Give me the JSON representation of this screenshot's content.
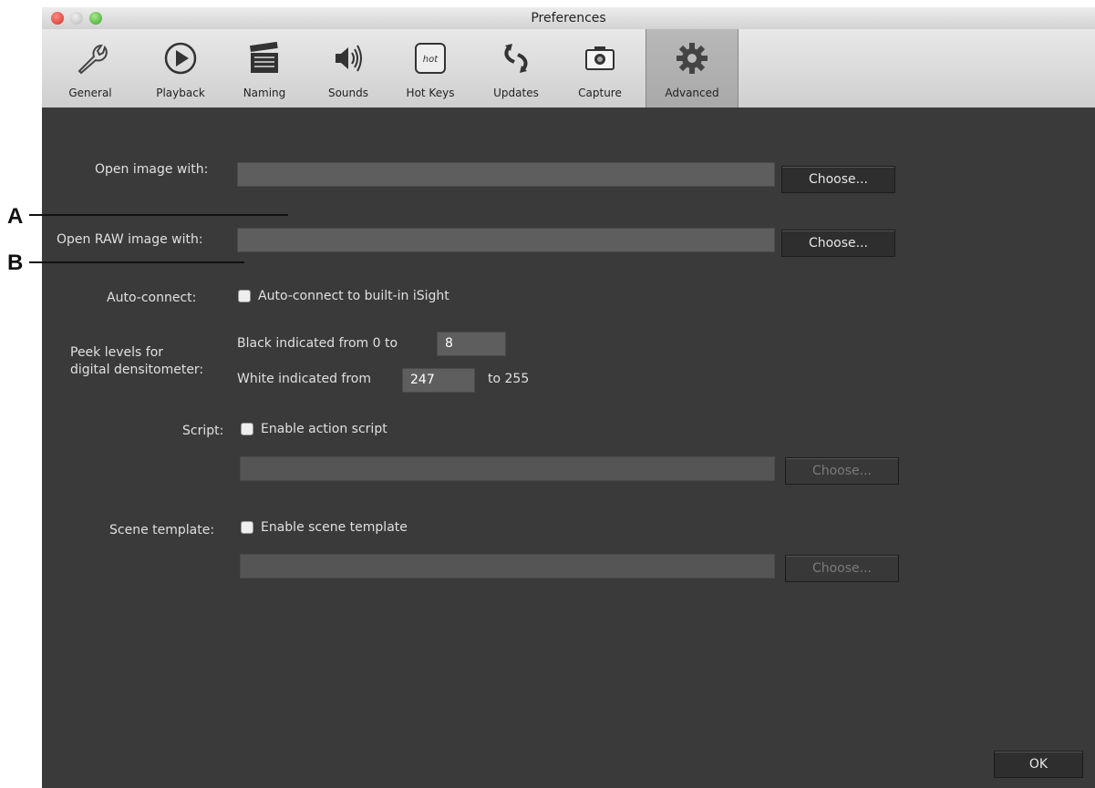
{
  "window": {
    "title": "Preferences"
  },
  "tabs": [
    {
      "label": "General",
      "icon": "wrench-icon"
    },
    {
      "label": "Playback",
      "icon": "play-icon"
    },
    {
      "label": "Naming",
      "icon": "clapperboard-icon"
    },
    {
      "label": "Sounds",
      "icon": "speaker-icon"
    },
    {
      "label": "Hot Keys",
      "icon": "hotkeys-icon"
    },
    {
      "label": "Updates",
      "icon": "updates-icon"
    },
    {
      "label": "Capture",
      "icon": "camera-icon"
    },
    {
      "label": "Advanced",
      "icon": "gear-icon",
      "selected": true
    }
  ],
  "form": {
    "open_image_label": "Open image with:",
    "open_image_value": "",
    "open_raw_label": "Open RAW image with:",
    "open_raw_value": "",
    "choose_label": "Choose...",
    "autoconnect_label": "Auto-connect:",
    "autoconnect_checkbox": "Auto-connect to built-in iSight",
    "peek_label_line1": "Peek levels for",
    "peek_label_line2": "digital densitometer:",
    "black_label": "Black indicated from 0 to",
    "black_value": "8",
    "white_label": "White indicated from",
    "white_value": "247",
    "white_suffix": "to 255",
    "script_label": "Script:",
    "script_checkbox": "Enable action script",
    "scene_label": "Scene template:",
    "scene_checkbox": "Enable scene template",
    "ok_label": "OK"
  },
  "annotations": {
    "a": "A",
    "b": "B"
  }
}
